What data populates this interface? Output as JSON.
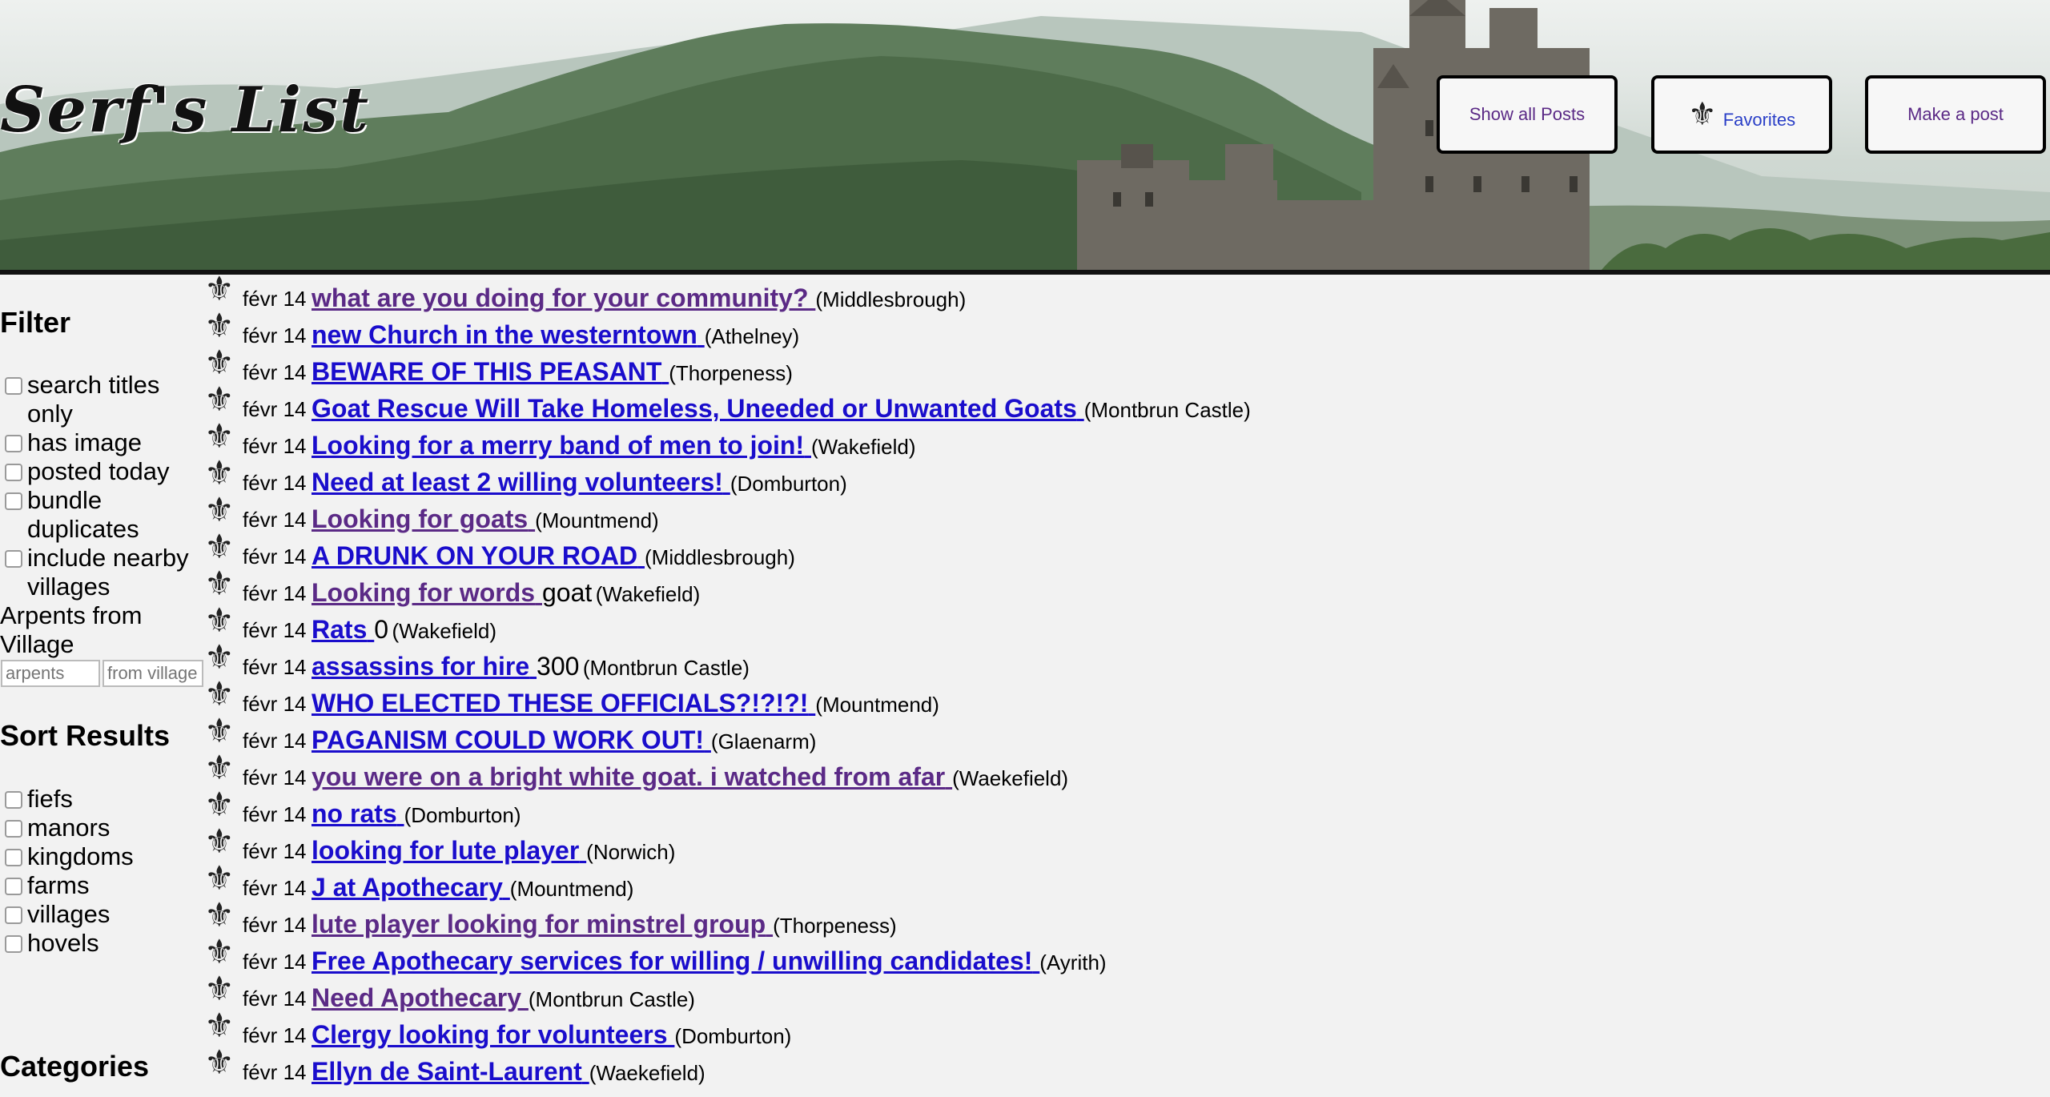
{
  "header": {
    "logo": "Serf's List",
    "nav": [
      {
        "label": "Show all Posts"
      },
      {
        "label": "Favorites",
        "icon": "fleur-de-lis-icon"
      },
      {
        "label": "Make a post"
      }
    ]
  },
  "sidebar": {
    "filter_title": "Filter",
    "filters": [
      {
        "label": "search titles only"
      },
      {
        "label": "has image"
      },
      {
        "label": "posted today"
      },
      {
        "label": "bundle duplicates"
      },
      {
        "label": "include nearby villages"
      }
    ],
    "arpents_label": "Arpents from Village",
    "arpents_placeholder": "arpents",
    "village_placeholder": "from village",
    "sort_title": "Sort Results",
    "sorts": [
      {
        "label": "fiefs"
      },
      {
        "label": "manors"
      },
      {
        "label": "kingdoms"
      },
      {
        "label": "farms"
      },
      {
        "label": "villages"
      },
      {
        "label": "hovels"
      }
    ],
    "categories_title": "Categories"
  },
  "posts": [
    {
      "date": "févr 14",
      "title": "what are you doing for your community?",
      "price": "",
      "location": "(Middlesbrough)",
      "visited": true
    },
    {
      "date": "févr 14",
      "title": "new Church in the westerntown",
      "price": "",
      "location": "(Athelney)",
      "visited": false
    },
    {
      "date": "févr 14",
      "title": "BEWARE OF THIS PEASANT",
      "price": "",
      "location": "(Thorpeness)",
      "visited": false
    },
    {
      "date": "févr 14",
      "title": "Goat Rescue Will Take Homeless, Uneeded or Unwanted Goats",
      "price": "",
      "location": "(Montbrun Castle)",
      "visited": false
    },
    {
      "date": "févr 14",
      "title": "Looking for a merry band of men to join!",
      "price": "",
      "location": "(Wakefield)",
      "visited": false
    },
    {
      "date": "févr 14",
      "title": "Need at least 2 willing volunteers!",
      "price": "",
      "location": "(Domburton)",
      "visited": false
    },
    {
      "date": "févr 14",
      "title": "Looking for goats",
      "price": "",
      "location": "(Mountmend)",
      "visited": true
    },
    {
      "date": "févr 14",
      "title": "A DRUNK ON YOUR ROAD",
      "price": "",
      "location": "(Middlesbrough)",
      "visited": false
    },
    {
      "date": "févr 14",
      "title": "Looking for words",
      "price": "goat",
      "location": "(Wakefield)",
      "visited": true
    },
    {
      "date": "févr 14",
      "title": "Rats",
      "price": "0",
      "location": "(Wakefield)",
      "visited": false
    },
    {
      "date": "févr 14",
      "title": "assassins for hire",
      "price": "300",
      "location": "(Montbrun Castle)",
      "visited": false
    },
    {
      "date": "févr 14",
      "title": "WHO ELECTED THESE OFFICIALS?!?!?!",
      "price": "",
      "location": "(Mountmend)",
      "visited": false
    },
    {
      "date": "févr 14",
      "title": "PAGANISM COULD WORK OUT!",
      "price": "",
      "location": "(Glaenarm)",
      "visited": false
    },
    {
      "date": "févr 14",
      "title": "you were on a bright white goat. i watched from afar",
      "price": "",
      "location": "(Waekefield)",
      "visited": true
    },
    {
      "date": "févr 14",
      "title": "no rats",
      "price": "",
      "location": "(Domburton)",
      "visited": false
    },
    {
      "date": "févr 14",
      "title": "looking for lute player",
      "price": "",
      "location": "(Norwich)",
      "visited": false
    },
    {
      "date": "févr 14",
      "title": "J at Apothecary",
      "price": "",
      "location": "(Mountmend)",
      "visited": false
    },
    {
      "date": "févr 14",
      "title": "lute player looking for minstrel group",
      "price": "",
      "location": "(Thorpeness)",
      "visited": true
    },
    {
      "date": "févr 14",
      "title": "Free Apothecary services for willing / unwilling candidates!",
      "price": "",
      "location": "(Ayrith)",
      "visited": false
    },
    {
      "date": "févr 14",
      "title": "Need Apothecary",
      "price": "",
      "location": "(Montbrun Castle)",
      "visited": true
    },
    {
      "date": "févr 14",
      "title": "Clergy looking for volunteers",
      "price": "",
      "location": "(Domburton)",
      "visited": false
    },
    {
      "date": "févr 14",
      "title": "Ellyn de Saint-Laurent",
      "price": "",
      "location": "(Waekefield)",
      "visited": false
    }
  ]
}
